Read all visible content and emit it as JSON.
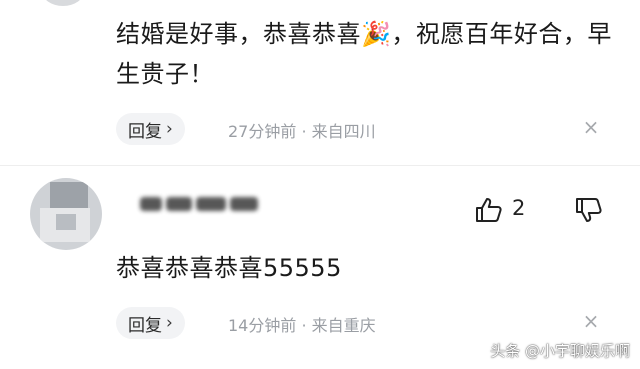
{
  "comments": [
    {
      "text": "结婚是好事，恭喜恭喜🎉，祝愿百年好合，早生贵子！",
      "reply_label": "回复",
      "chevron": "›",
      "meta": "27分钟前 · 来自四川",
      "close": "×"
    },
    {
      "text": "恭喜恭喜恭喜55555",
      "like_count": "2",
      "reply_label": "回复",
      "chevron": "›",
      "meta": "14分钟前 · 来自重庆",
      "close": "×"
    }
  ],
  "watermark": "头条 @小宇聊娱乐啊",
  "icons": {
    "like": "thumbs-up-icon",
    "dislike": "thumbs-down-icon",
    "close": "close-icon"
  },
  "colors": {
    "text": "#1a1a1a",
    "meta": "#9a9ea4",
    "reply_bg": "#f2f3f5"
  }
}
